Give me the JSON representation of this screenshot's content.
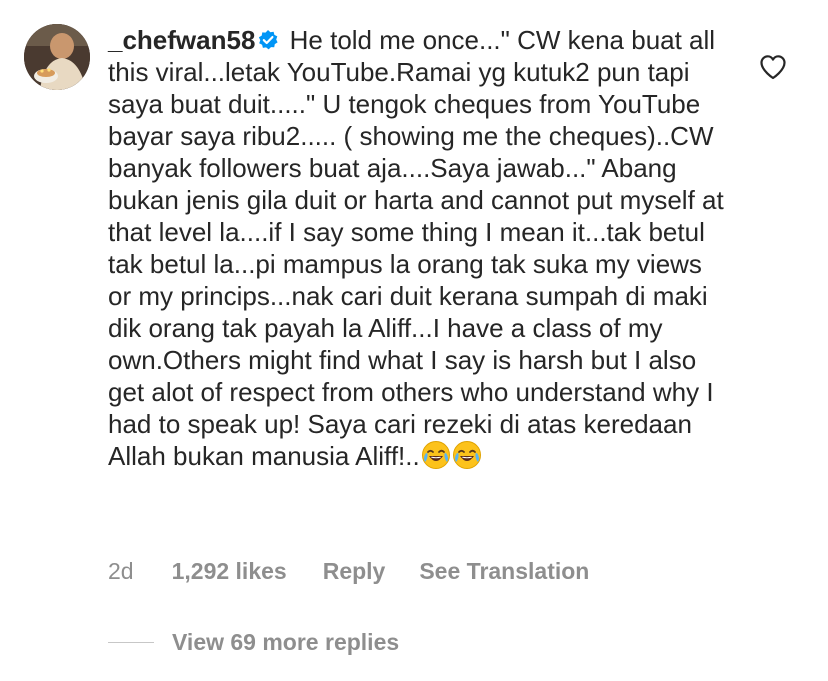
{
  "comment": {
    "username": "_chefwan58",
    "verified_icon": "verified-badge-icon",
    "text": "He told me once...\" CW kena buat all this viral...letak YouTube.Ramai yg kutuk2 pun tapi saya buat duit.....\" U tengok cheques from YouTube bayar saya ribu2..... ( showing me the cheques)..CW banyak followers buat aja....Saya jawab...\" Abang bukan jenis gila duit or harta and cannot put myself at that level la....if I say some thing I mean it...tak betul tak betul la...pi mampus la orang tak suka my views or my princips...nak cari duit kerana sumpah di maki dik orang tak payah la Aliff...I have a class of my own.Others might find what I say is harsh but I also get alot of respect from others who understand why I had to speak up! Saya cari rezeki di atas keredaan Allah bukan manusia Aliff!..",
    "trailing_emojis": [
      "face-with-tears-of-joy-emoji",
      "face-with-tears-of-joy-emoji"
    ],
    "like_icon": "heart-outline-icon"
  },
  "meta": {
    "time": "2d",
    "likes": "1,292 likes",
    "reply": "Reply",
    "translate": "See Translation"
  },
  "replies": {
    "label": "View 69 more replies"
  },
  "colors": {
    "text": "#262626",
    "secondary": "#8e8e8e",
    "verified": "#0095f6"
  }
}
